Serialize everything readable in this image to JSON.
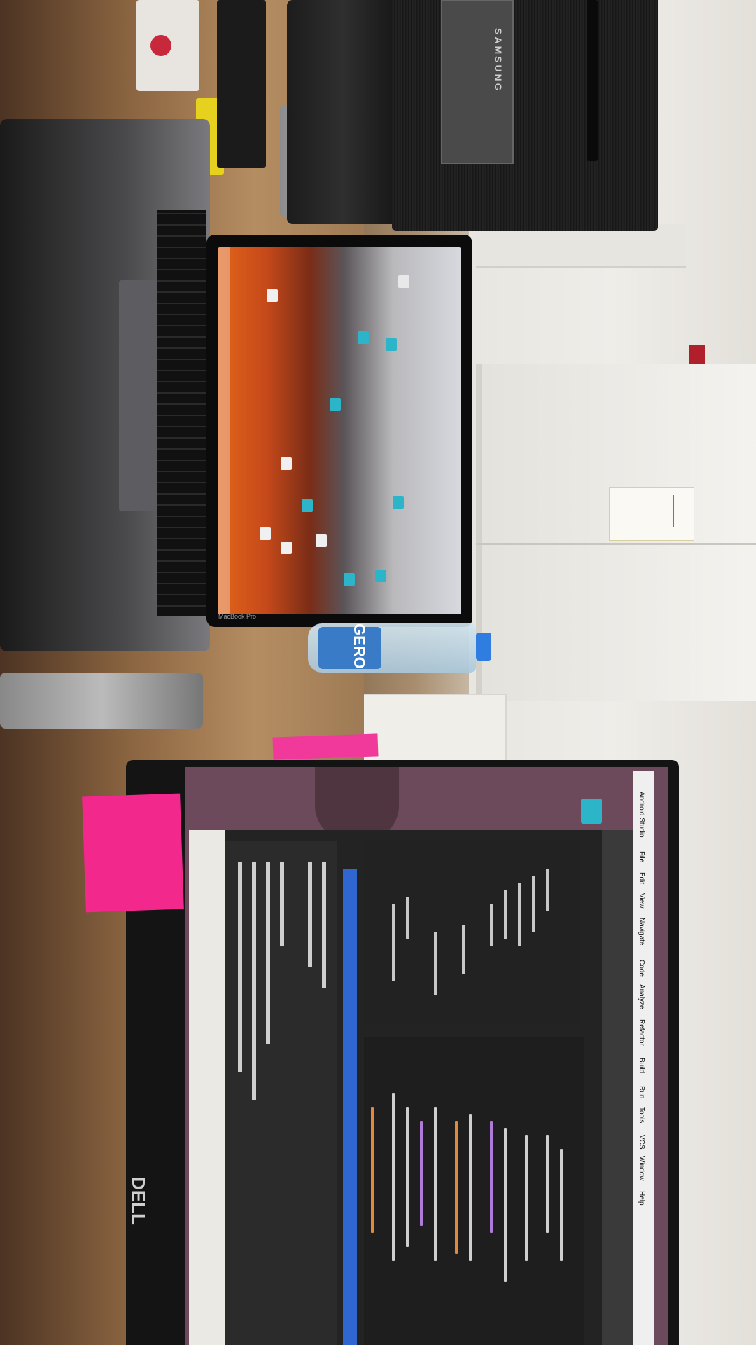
{
  "scene": {
    "description_type": "photo",
    "orientation": "rotated-90"
  },
  "samsung_monitor": {
    "brand": "SAMSUNG"
  },
  "laptop": {
    "brand": "MacBook Pro"
  },
  "water_bottle": {
    "label": "GERO"
  },
  "dell_monitor": {
    "brand": "DELL"
  },
  "ide": {
    "menu": [
      "Android Studio",
      "File",
      "Edit",
      "View",
      "Navigate",
      "Code",
      "Analyze",
      "Refactor",
      "Build",
      "Run",
      "Tools",
      "VCS",
      "Window",
      "Help"
    ]
  },
  "colors": {
    "sticky_note": "#f2288c",
    "bottle_cap": "#2f7de0",
    "ide_accent": "#2f66d0"
  }
}
